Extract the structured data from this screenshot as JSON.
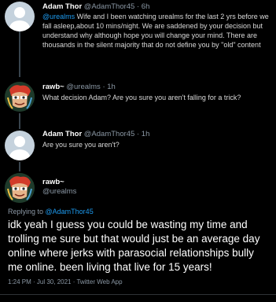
{
  "tweets": [
    {
      "name": "Adam Thor",
      "handle": "@AdamThor45",
      "time": "6h",
      "mention": "@urealms",
      "text": " Wife and I been watching urealms for the last 2 yrs before we fall asleep,about 10 mins/night. We are saddened by your decision but understand why although hope you will change your mind. There are thousands in the silent majority that do not define you by \"old\" content"
    },
    {
      "name": "rawb~",
      "handle": "@urealms",
      "time": "1h",
      "text": "What decision Adam? Are you sure you aren't falling for a trick?"
    },
    {
      "name": "Adam Thor",
      "handle": "@AdamThor45",
      "time": "1h",
      "text": "Are you sure you aren't?"
    }
  ],
  "main": {
    "name": "rawb~",
    "handle": "@urealms",
    "replying_prefix": "Replying to ",
    "replying_to": "@AdamThor45",
    "text": "idk yeah I guess you could be wasting my time and trolling me sure but that would just be an average day online where jerks with parasocial relationships bully me online. been living that live for 15 years!",
    "meta": "1:24 PM · Jul 30, 2021 · Twitter Web App"
  },
  "separator": " · ",
  "colors": {
    "background": "#000000",
    "link": "#1d9bf0",
    "secondary_text": "#8b98a5",
    "thread_line": "#38444d"
  }
}
